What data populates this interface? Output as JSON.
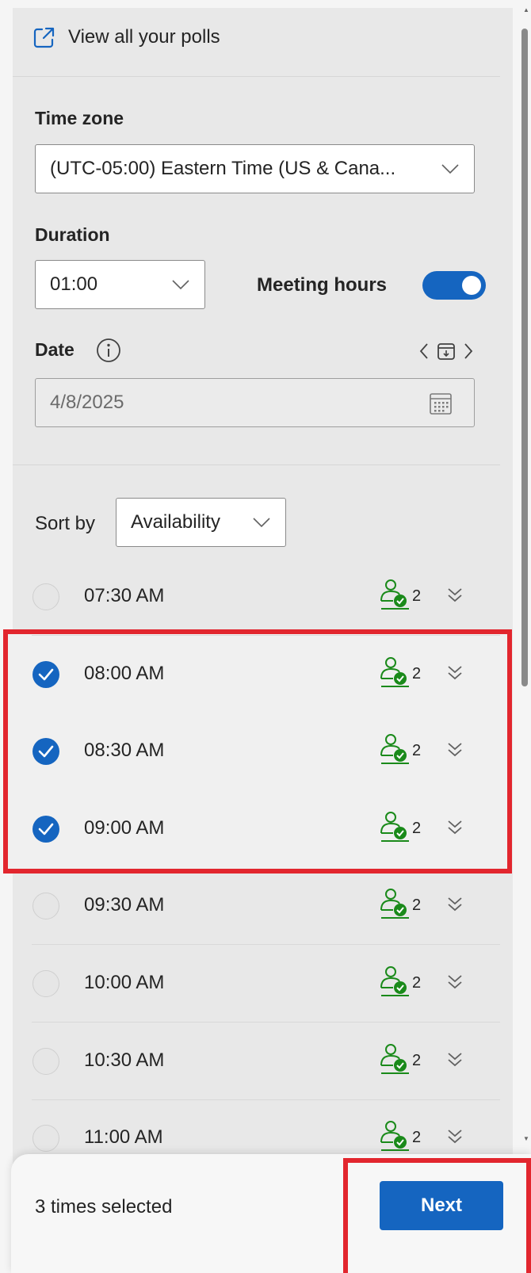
{
  "header": {
    "view_polls_label": "View all your polls"
  },
  "time_zone": {
    "label": "Time zone",
    "value": "(UTC-05:00) Eastern Time (US & Cana..."
  },
  "duration": {
    "label": "Duration",
    "value": "01:00"
  },
  "meeting_hours": {
    "label": "Meeting hours",
    "enabled": true
  },
  "date": {
    "label": "Date",
    "value": "4/8/2025"
  },
  "sort": {
    "label": "Sort by",
    "value": "Availability"
  },
  "slots": [
    {
      "time": "07:30 AM",
      "attendees": "2",
      "selected": false
    },
    {
      "time": "08:00 AM",
      "attendees": "2",
      "selected": true
    },
    {
      "time": "08:30 AM",
      "attendees": "2",
      "selected": true
    },
    {
      "time": "09:00 AM",
      "attendees": "2",
      "selected": true
    },
    {
      "time": "09:30 AM",
      "attendees": "2",
      "selected": false
    },
    {
      "time": "10:00 AM",
      "attendees": "2",
      "selected": false
    },
    {
      "time": "10:30 AM",
      "attendees": "2",
      "selected": false
    },
    {
      "time": "11:00 AM",
      "attendees": "2",
      "selected": false
    }
  ],
  "footer": {
    "selected_text": "3 times selected",
    "next_label": "Next"
  },
  "colors": {
    "accent": "#1565c0",
    "highlight": "#e2262e",
    "available": "#1a8a1a"
  }
}
